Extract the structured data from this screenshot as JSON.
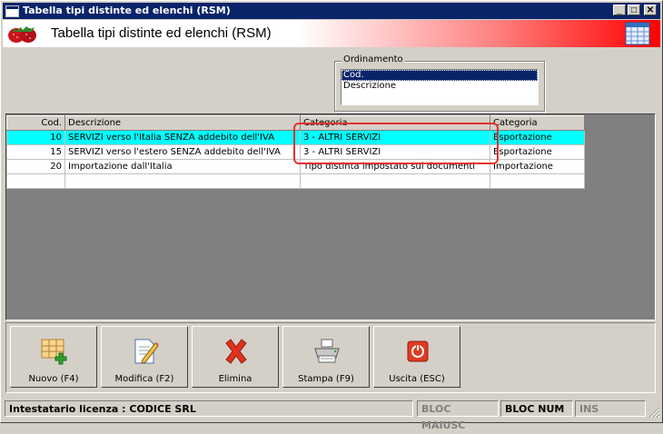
{
  "window": {
    "title": "Tabella tipi distinte ed elenchi (RSM)",
    "minimize": "_",
    "maximize": "□",
    "close": "✕"
  },
  "header": {
    "title": "Tabella tipi distinte ed elenchi (RSM)"
  },
  "sort": {
    "label": "Ordinamento",
    "options": [
      "Cod.",
      "Descrizione"
    ],
    "selected": "Cod."
  },
  "grid": {
    "columns": [
      "Cod.",
      "Descrizione",
      "Categoria",
      "Categoria"
    ],
    "rows": [
      {
        "cod": "10",
        "descrizione": "SERVIZI verso l'Italia SENZA addebito dell'IVA",
        "categoria": "3 - ALTRI SERVIZI",
        "categoria2": "Esportazione",
        "highlight": true
      },
      {
        "cod": "15",
        "descrizione": "SERVIZI verso l'estero SENZA addebito dell'IVA",
        "categoria": "3 - ALTRI SERVIZI",
        "categoria2": "Esportazione",
        "highlight": false
      },
      {
        "cod": "20",
        "descrizione": "Importazione dall'Italia",
        "categoria": "Tipo distinta impostato sui documenti",
        "categoria2": "Importazione",
        "highlight": false
      }
    ]
  },
  "toolbar": {
    "new": "Nuovo (F4)",
    "edit": "Modifica (F2)",
    "delete": "Elimina",
    "print": "Stampa (F9)",
    "exit": "Uscita (ESC)"
  },
  "status": {
    "license": "Intestatario licenza : CODICE SRL",
    "caps": "BLOC MAIUSC",
    "num": "BLOC NUM",
    "ins": "INS"
  },
  "colors": {
    "titlebar": "#0a246a",
    "highlight_row": "#00ffff",
    "annotation": "#e53030"
  }
}
